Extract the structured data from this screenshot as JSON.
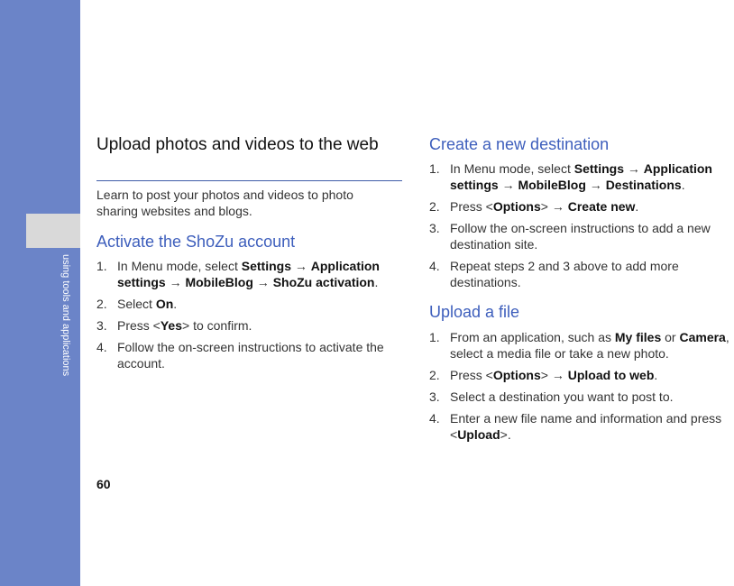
{
  "sidebar": {
    "label": "using tools and applications"
  },
  "page_number": "60",
  "section": {
    "title": "Upload photos and videos to the web",
    "intro": "Learn to post your photos and videos to photo sharing websites and blogs."
  },
  "activate": {
    "heading": "Activate the ShoZu account",
    "steps": [
      {
        "num": "1.",
        "parts": [
          {
            "t": "In Menu mode, select "
          },
          {
            "t": "Settings",
            "b": true
          },
          {
            "t": " → "
          },
          {
            "t": "Application settings",
            "b": true
          },
          {
            "t": " → "
          },
          {
            "t": "MobileBlog",
            "b": true
          },
          {
            "t": " → "
          },
          {
            "t": "ShoZu activation",
            "b": true
          },
          {
            "t": "."
          }
        ]
      },
      {
        "num": "2.",
        "parts": [
          {
            "t": "Select "
          },
          {
            "t": "On",
            "b": true
          },
          {
            "t": "."
          }
        ]
      },
      {
        "num": "3.",
        "parts": [
          {
            "t": "Press <"
          },
          {
            "t": "Yes",
            "b": true
          },
          {
            "t": "> to confirm."
          }
        ]
      },
      {
        "num": "4.",
        "parts": [
          {
            "t": "Follow the on-screen instructions to activate the account."
          }
        ]
      }
    ]
  },
  "destination": {
    "heading": "Create a new destination",
    "steps": [
      {
        "num": "1.",
        "parts": [
          {
            "t": "In Menu mode, select "
          },
          {
            "t": "Settings",
            "b": true
          },
          {
            "t": " → "
          },
          {
            "t": "Application settings",
            "b": true
          },
          {
            "t": " → "
          },
          {
            "t": "MobileBlog",
            "b": true
          },
          {
            "t": " → "
          },
          {
            "t": "Destinations",
            "b": true
          },
          {
            "t": "."
          }
        ]
      },
      {
        "num": "2.",
        "parts": [
          {
            "t": "Press <"
          },
          {
            "t": "Options",
            "b": true
          },
          {
            "t": "> → "
          },
          {
            "t": "Create new",
            "b": true
          },
          {
            "t": "."
          }
        ]
      },
      {
        "num": "3.",
        "parts": [
          {
            "t": "Follow the on-screen instructions to add a new destination site."
          }
        ]
      },
      {
        "num": "4.",
        "parts": [
          {
            "t": "Repeat steps 2 and 3 above to add more destinations."
          }
        ]
      }
    ]
  },
  "upload": {
    "heading": "Upload a file",
    "steps": [
      {
        "num": "1.",
        "parts": [
          {
            "t": "From an application, such as "
          },
          {
            "t": "My files",
            "b": true
          },
          {
            "t": " or "
          },
          {
            "t": "Camera",
            "b": true
          },
          {
            "t": ", select a media file or take a new photo."
          }
        ]
      },
      {
        "num": "2.",
        "parts": [
          {
            "t": "Press <"
          },
          {
            "t": "Options",
            "b": true
          },
          {
            "t": "> → "
          },
          {
            "t": "Upload to web",
            "b": true
          },
          {
            "t": "."
          }
        ]
      },
      {
        "num": "3.",
        "parts": [
          {
            "t": "Select a destination you want to post to."
          }
        ]
      },
      {
        "num": "4.",
        "parts": [
          {
            "t": "Enter a new file name and information and press <"
          },
          {
            "t": "Upload",
            "b": true
          },
          {
            "t": ">."
          }
        ]
      }
    ]
  }
}
